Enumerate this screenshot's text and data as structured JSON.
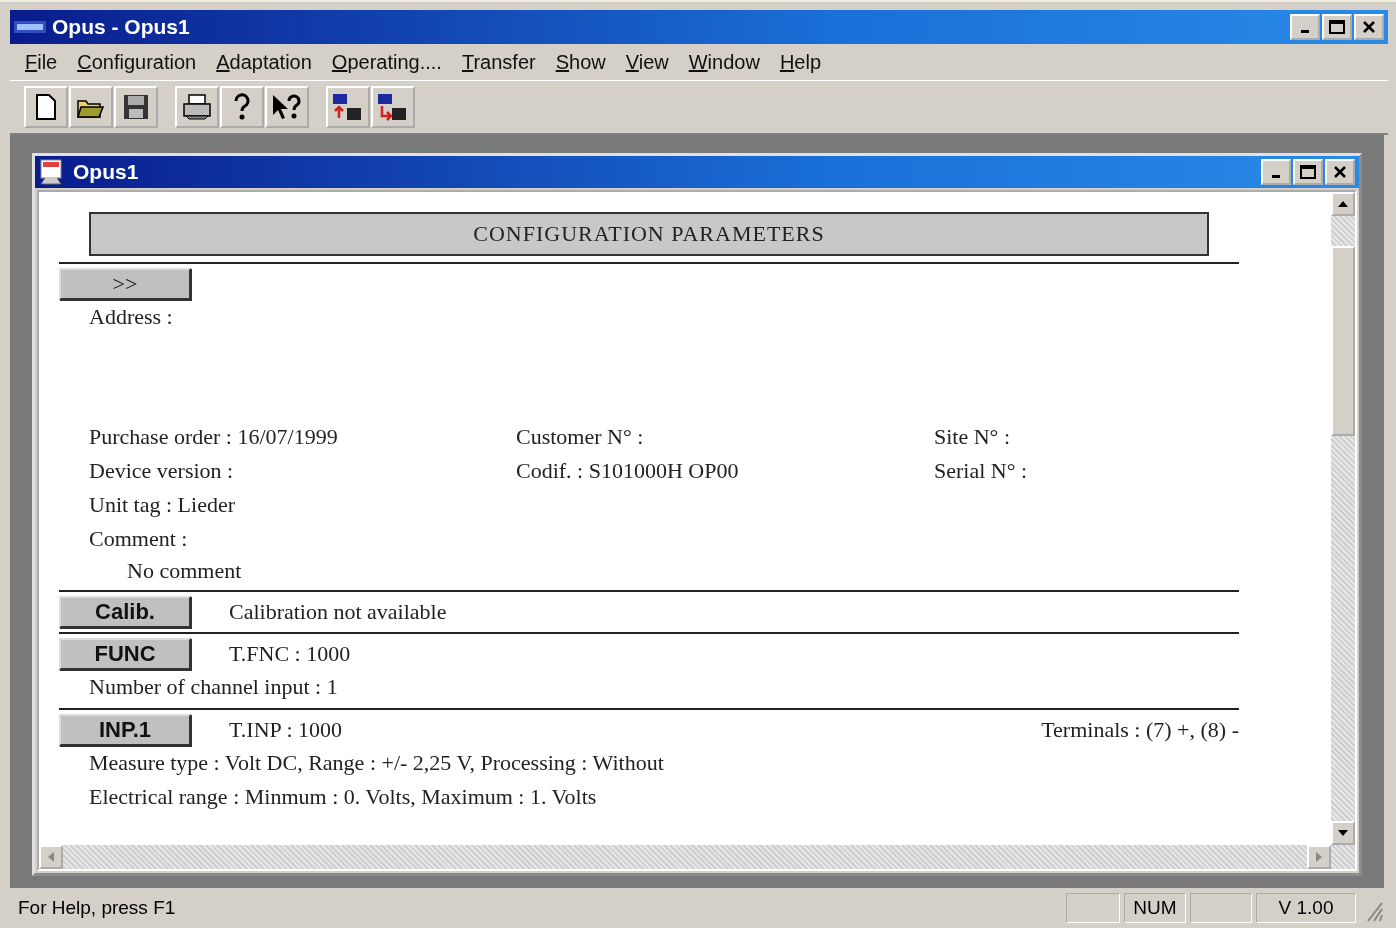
{
  "window": {
    "title": "Opus - Opus1"
  },
  "menu": [
    "File",
    "Configuration",
    "Adaptation",
    "Operating....",
    "Transfer",
    "Show",
    "View",
    "Window",
    "Help"
  ],
  "toolbar": [
    {
      "kind": "new"
    },
    {
      "kind": "open"
    },
    {
      "kind": "save"
    },
    {
      "kind": "sep"
    },
    {
      "kind": "print"
    },
    {
      "kind": "help"
    },
    {
      "kind": "context-help"
    },
    {
      "kind": "sep"
    },
    {
      "kind": "upload"
    },
    {
      "kind": "download"
    }
  ],
  "document": {
    "title": "Opus1",
    "header": "CONFIGURATION PARAMETERS",
    "intro": {
      "button": ">>",
      "address": "Address :",
      "grid": [
        [
          "Purchase order : 16/07/1999",
          "Customer N° :",
          "Site N° :"
        ],
        [
          "Device version  :",
          "Codif. : S101000H OP00",
          "Serial N° :"
        ],
        [
          "Unit tag : Lieder"
        ],
        [
          "Comment :"
        ]
      ],
      "comment": "No comment"
    },
    "sections": [
      {
        "button": "Calib.",
        "summary": "Calibration not available"
      },
      {
        "button": "FUNC",
        "summary": "T.FNC : 1000",
        "lines": [
          "Number of channel input : 1"
        ]
      },
      {
        "button": "INP.1",
        "summary": "T.INP : 1000",
        "right": "Terminals : (7) +, (8) -",
        "lines": [
          "Measure type : Volt DC, Range : +/- 2,25 V, Processing : Without",
          "Electrical range : Minmum : 0. Volts, Maximum : 1. Volts"
        ]
      }
    ]
  },
  "status_bar": {
    "help": "For Help, press F1",
    "panes": [
      "NUM",
      "V 1.00"
    ]
  }
}
